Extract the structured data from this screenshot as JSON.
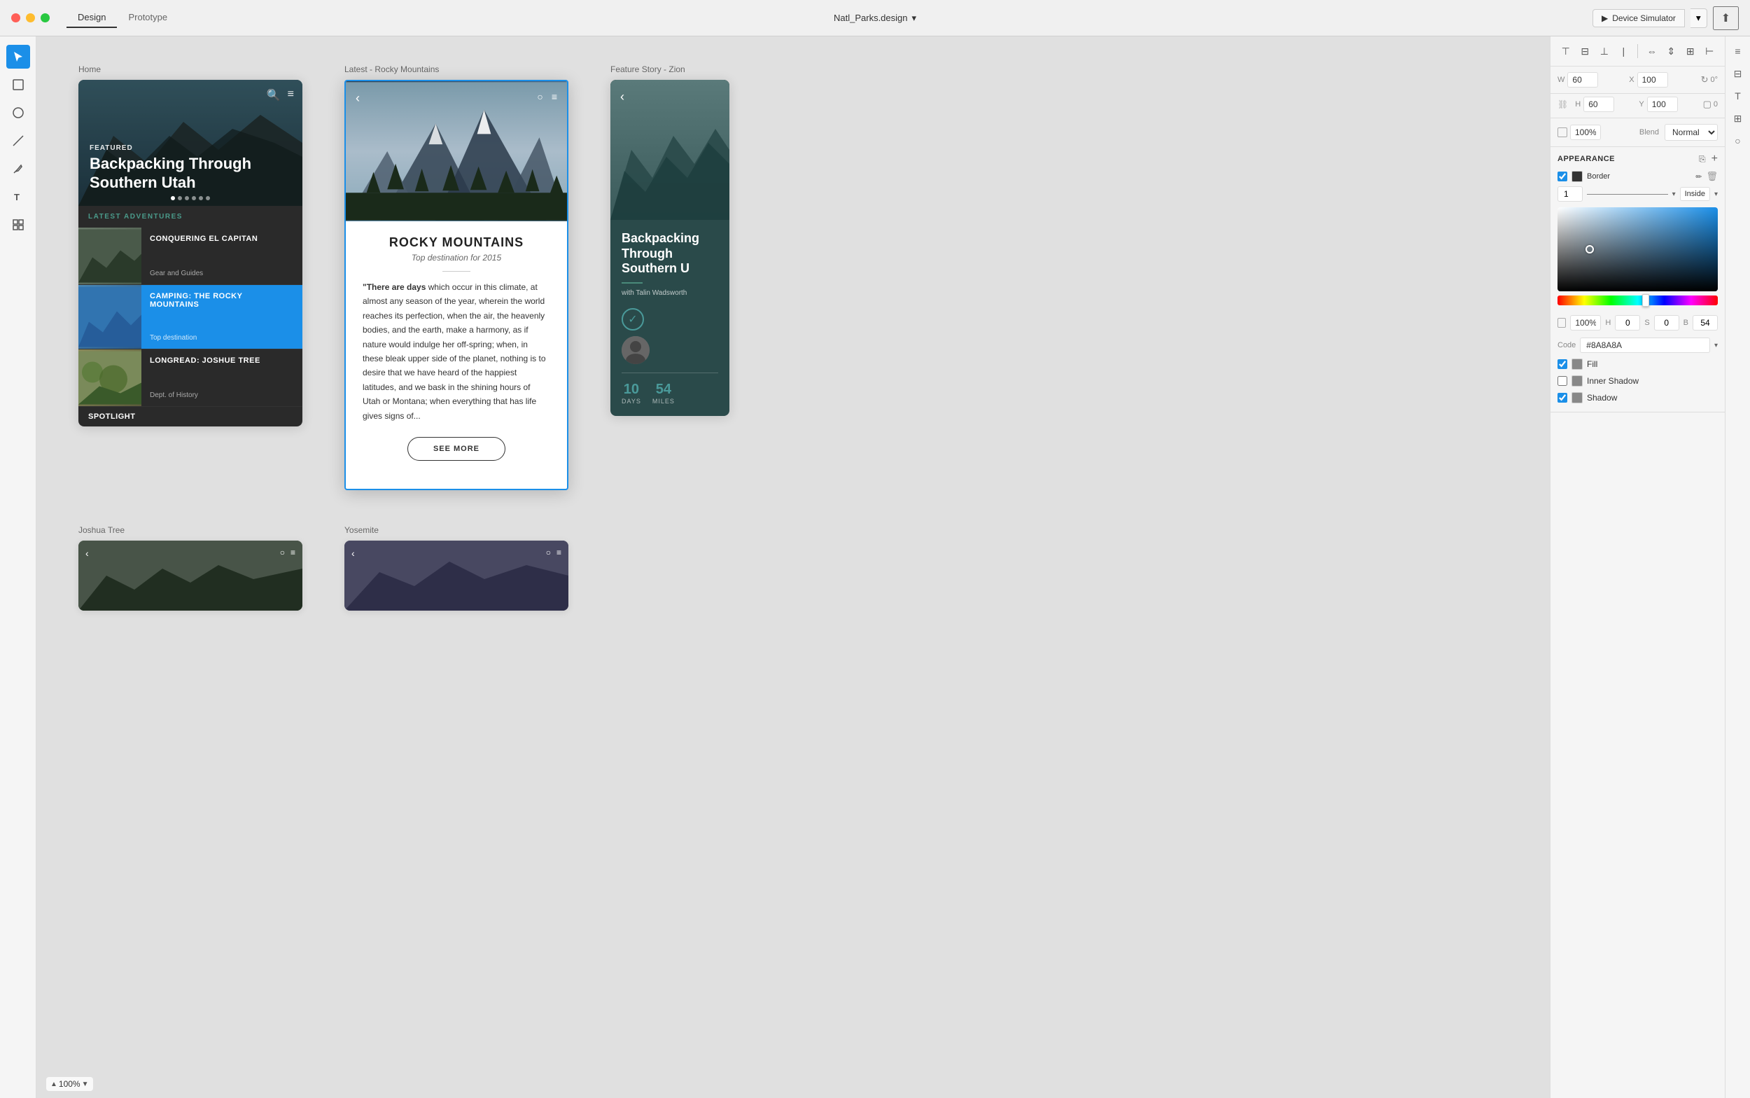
{
  "titlebar": {
    "tabs": [
      "Design",
      "Prototype"
    ],
    "active_tab": "Design",
    "file_name": "Natl_Parks.design",
    "device_sim_label": "Device Simulator",
    "export_icon": "↑"
  },
  "toolbar_left": {
    "tools": [
      "cursor",
      "rectangle",
      "circle",
      "line",
      "pen",
      "text",
      "component"
    ]
  },
  "canvas": {
    "phones": [
      {
        "label": "Home",
        "hero": {
          "featured_label": "FEATURED",
          "title": "Backpacking Through Southern Utah"
        },
        "list_header": "LATEST ADVENTURES",
        "items": [
          {
            "title": "CONQUERING EL CAPITAN",
            "subtitle": "Gear and Guides",
            "highlighted": false
          },
          {
            "title": "CAMPING: THE ROCKY MOUNTAINS",
            "subtitle": "Top destination",
            "highlighted": true
          },
          {
            "title": "LONGREAD: JOSHUE TREE",
            "subtitle": "Dept. of History",
            "highlighted": false
          }
        ],
        "bottom_label": "SPOTLIGHT"
      },
      {
        "label": "Latest - Rocky Mountains",
        "title": "ROCKY MOUNTAINS",
        "subtitle": "Top destination for 2015",
        "quote": "\"There are days which occur in this climate, at almost any season of the year, wherein the world reaches its perfection, when the air, the heavenly bodies, and the earth, make a harmony, as if nature would indulge her off-spring; when, in these bleak upper side of the planet, nothing is to desire that we have heard of the happiest latitudes, and we bask in the shining hours of Utah or Montana; when everything that has life gives signs of...",
        "see_more": "SEE MORE"
      },
      {
        "label": "Feature Story - Zion",
        "title": "Backpacking Through Southern U",
        "author": "with Talin Wadsworth",
        "days": "10",
        "days_label": "DAYS",
        "miles": "54",
        "miles_label": "MILES"
      }
    ],
    "bottom_phones": [
      {
        "label": "Joshua Tree"
      },
      {
        "label": "Yosemite"
      }
    ]
  },
  "right_panel": {
    "dimensions": {
      "w_label": "W",
      "w_value": "60",
      "x_label": "X",
      "x_value": "100",
      "rotate_label": "0°",
      "h_label": "H",
      "h_value": "60",
      "y_label": "Y",
      "y_value": "100",
      "corners_value": "0"
    },
    "opacity": "100%",
    "blend_label": "Blend",
    "blend_value": "Normal",
    "appearance_title": "APPEARANCE",
    "border": {
      "label": "Border",
      "width": "1",
      "position": "Inside"
    },
    "color": {
      "h_label": "H",
      "h_value": "0",
      "s_label": "S",
      "s_value": "0",
      "b_label": "B",
      "b_value": "54",
      "hex_label": "Code",
      "hex_value": "#8A8A8A"
    },
    "fill_label": "Fill",
    "inner_shadow_label": "Inner Shadow",
    "shadow_label": "Shadow"
  },
  "bottom_bar": {
    "zoom": "100%"
  }
}
